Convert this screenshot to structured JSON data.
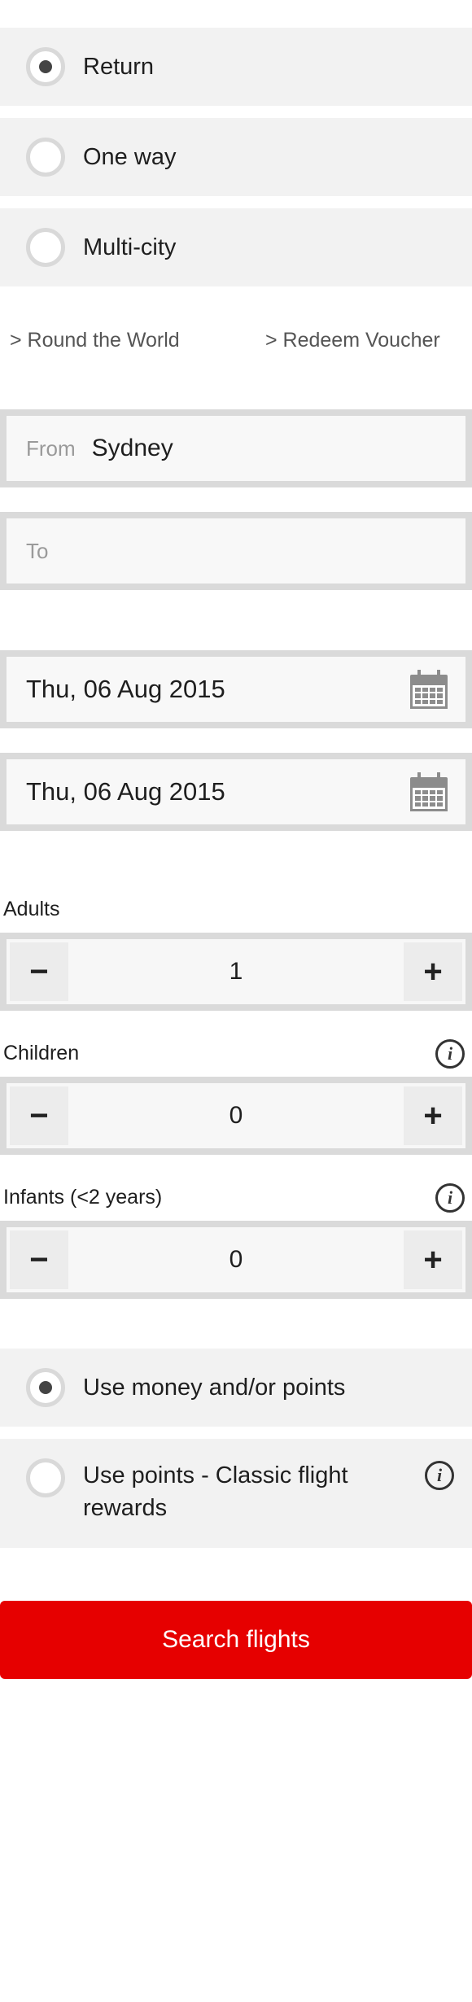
{
  "trip_type": {
    "options": [
      {
        "label": "Return",
        "selected": true
      },
      {
        "label": "One way",
        "selected": false
      },
      {
        "label": "Multi-city",
        "selected": false
      }
    ]
  },
  "links": {
    "round_the_world": "> Round the World",
    "redeem_voucher": "> Redeem Voucher"
  },
  "from": {
    "label": "From",
    "value": "Sydney"
  },
  "to": {
    "placeholder": "To",
    "value": ""
  },
  "dates": {
    "departure": "Thu, 06 Aug 2015",
    "return": "Thu, 06 Aug 2015"
  },
  "passengers": {
    "adults": {
      "label": "Adults",
      "value": "1"
    },
    "children": {
      "label": "Children",
      "value": "0"
    },
    "infants": {
      "label": "Infants (<2 years)",
      "value": "0"
    },
    "minus_symbol": "−",
    "plus_symbol": "+"
  },
  "payment": {
    "options": [
      {
        "label": "Use money and/or points",
        "selected": true
      },
      {
        "label": "Use points - Classic flight rewards",
        "selected": false
      }
    ]
  },
  "search_button": "Search flights",
  "icons": {
    "calendar": "calendar-icon",
    "info": "info-icon",
    "info_glyph": "i"
  },
  "colors": {
    "accent": "#e60000",
    "panel": "#f2f2f2",
    "border": "#dadada"
  }
}
